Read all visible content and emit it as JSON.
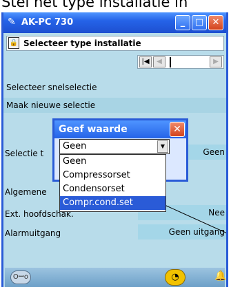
{
  "caption": "Stel het type installatie in",
  "window": {
    "title": "AK-PC 730",
    "app_icon": "✎",
    "buttons": {
      "minimize": "_",
      "maximize": "□",
      "close": "✕"
    }
  },
  "header": {
    "lock_icon": "🔒",
    "title": "Selecteer type installatie"
  },
  "nav": {
    "first": "|◀",
    "prev": "◀",
    "next": "▶"
  },
  "rows": {
    "quick_select_label": "Selecteer snelselectie",
    "new_selection_label": "Maak nieuwe selectie",
    "selection_label": "Selectie t",
    "selection_value": "Geen",
    "general_label": "Algemene",
    "ext_main_switch_label": "Ext. hoofdschak.",
    "ext_main_switch_value": "Nee",
    "alarm_output_label": "Alarmuitgang",
    "alarm_output_value": "Geen uitgang"
  },
  "dialog": {
    "title": "Geef waarde",
    "close": "✕",
    "combo_value": "Geen",
    "combo_arrow": "▼",
    "options": [
      "Geen",
      "Compressorset",
      "Condensorset",
      "Compr.cond.set"
    ],
    "selected_option": "Compr.cond.set"
  },
  "bottom_bar": {
    "glasses_icon": "Oꟷo",
    "clock_icon": "◔",
    "bell_icon": "🔔"
  },
  "colors": {
    "titlebar": "#2563e8",
    "band": "#a8d4e4",
    "window_bg": "#b8dcea",
    "selection": "#2a5bd7"
  }
}
